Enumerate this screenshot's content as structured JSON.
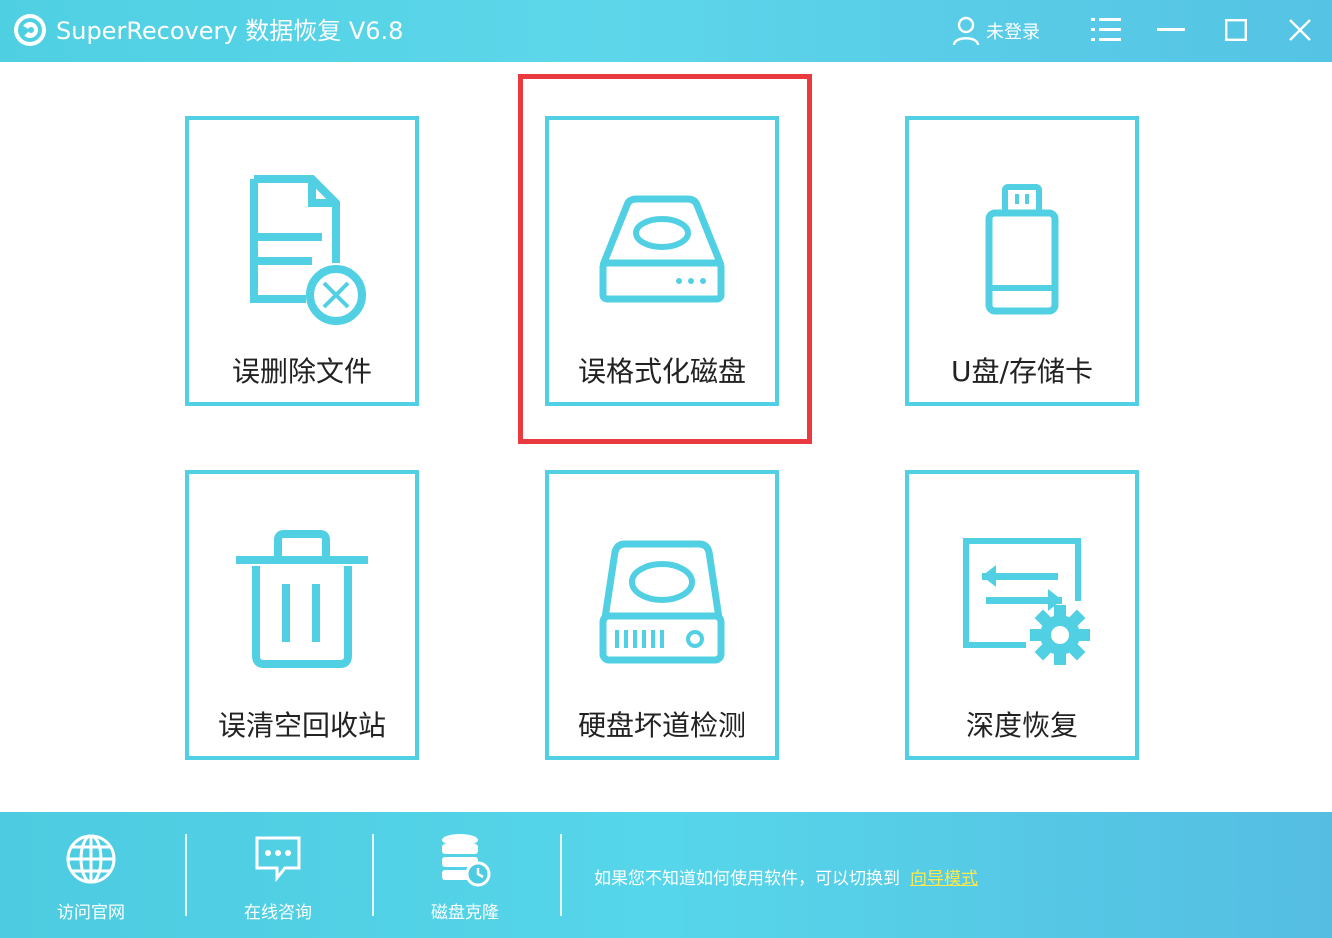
{
  "window": {
    "title": "SuperRecovery 数据恢复 V6.8",
    "user_label": "未登录",
    "icons": [
      "logo-icon",
      "user-icon",
      "menu-icon",
      "minimize-icon",
      "maximize-icon",
      "close-icon"
    ]
  },
  "tiles": [
    {
      "label": "误删除文件",
      "icon": "deleted-file-icon"
    },
    {
      "label": "误格式化磁盘",
      "icon": "format-disk-icon"
    },
    {
      "label": "U盘/存储卡",
      "icon": "usb-drive-icon"
    },
    {
      "label": "误清空回收站",
      "icon": "recycle-bin-icon"
    },
    {
      "label": "硬盘坏道检测",
      "icon": "hard-disk-icon"
    },
    {
      "label": "深度恢复",
      "icon": "deep-recovery-icon"
    }
  ],
  "footer": {
    "items": [
      {
        "label": "访问官网",
        "icon": "globe-icon"
      },
      {
        "label": "在线咨询",
        "icon": "chat-icon"
      },
      {
        "label": "磁盘克隆",
        "icon": "database-clone-icon"
      }
    ],
    "hint_text": "如果您不知道如何使用软件，可以切换到",
    "hint_link": "向导模式"
  },
  "colors": {
    "accent": "#52d0e3",
    "highlight": "#e83a3f",
    "link": "#ffe94a"
  }
}
